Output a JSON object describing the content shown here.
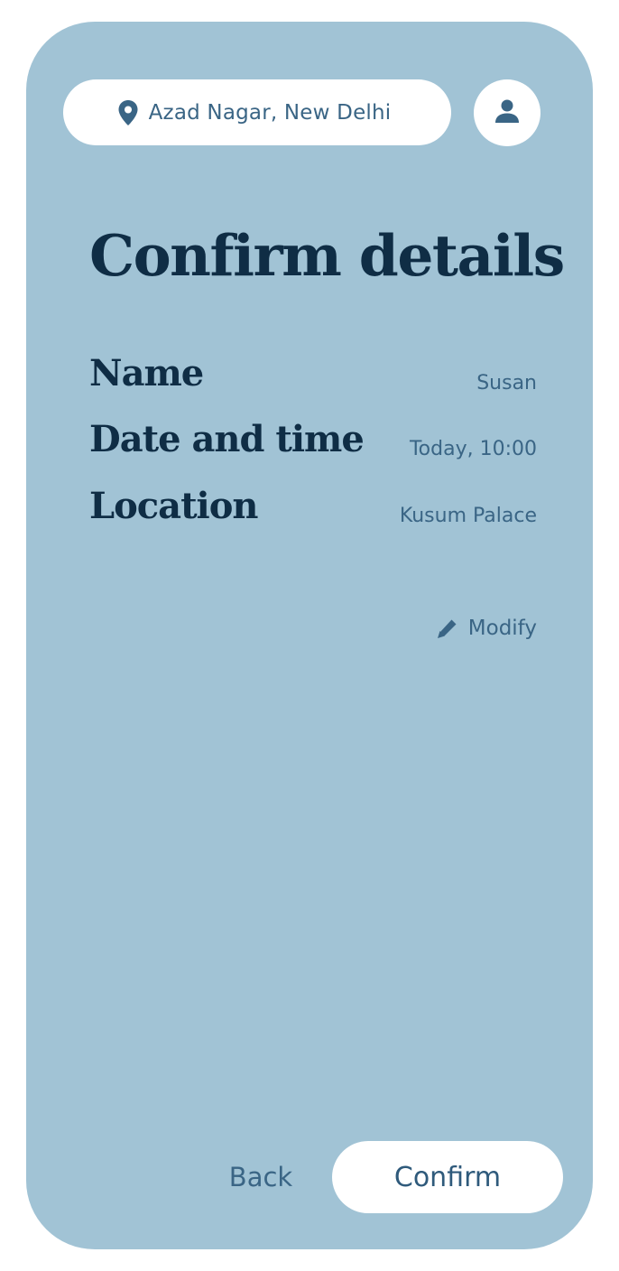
{
  "header": {
    "location": "Azad Nagar, New Delhi",
    "location_icon": "map-pin-icon",
    "profile_icon": "user-icon"
  },
  "main": {
    "title": "Confirm details",
    "details": [
      {
        "label": "Name",
        "value": "Susan"
      },
      {
        "label": "Date and time",
        "value": "Today, 10:00"
      },
      {
        "label": "Location",
        "value": "Kusum Palace"
      }
    ],
    "modify_label": "Modify",
    "modify_icon": "pencil-icon"
  },
  "footer": {
    "back_label": "Back",
    "confirm_label": "Confirm"
  },
  "colors": {
    "card_background": "#a1c3d5",
    "heading": "#0f2d45",
    "accent_text": "#3a6585",
    "button_background": "#ffffff"
  }
}
